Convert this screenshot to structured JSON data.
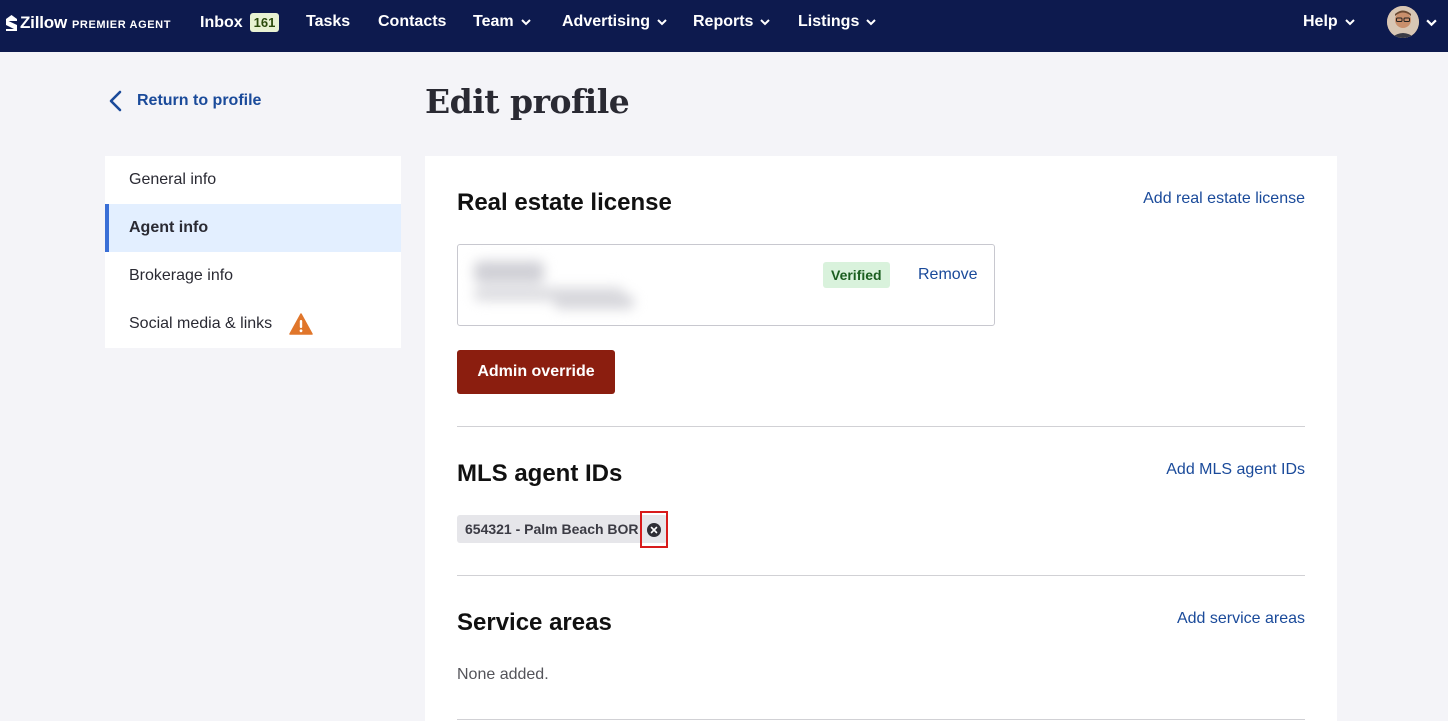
{
  "topnav": {
    "brand": "Zillow",
    "brand_sub": "PREMIER AGENT",
    "items": [
      {
        "label": "Inbox",
        "badge": "161"
      },
      {
        "label": "Tasks"
      },
      {
        "label": "Contacts"
      },
      {
        "label": "Team"
      },
      {
        "label": "Advertising"
      },
      {
        "label": "Reports"
      },
      {
        "label": "Listings"
      }
    ],
    "help": "Help"
  },
  "sidebar": {
    "back_label": "Return to profile",
    "items": [
      {
        "label": "General info"
      },
      {
        "label": "Agent info"
      },
      {
        "label": "Brokerage info"
      },
      {
        "label": "Social media & links"
      }
    ]
  },
  "main": {
    "title": "Edit profile",
    "license": {
      "heading": "Real estate license",
      "add_link": "Add real estate license",
      "status": "Verified",
      "remove": "Remove",
      "admin_button": "Admin override"
    },
    "mls": {
      "heading": "MLS agent IDs",
      "add_link": "Add MLS agent IDs",
      "chip": "654321 - Palm Beach BOR"
    },
    "service_areas": {
      "heading": "Service areas",
      "add_link": "Add service areas",
      "empty": "None added."
    }
  },
  "colors": {
    "nav_bg": "#0d1a4e",
    "link": "#1a4a9a",
    "admin_button": "#8b1e0f",
    "verified_bg": "#d9f2dc",
    "active_bg": "#e3efff",
    "warning": "#e0762b",
    "highlight_box": "#d81b1b"
  }
}
